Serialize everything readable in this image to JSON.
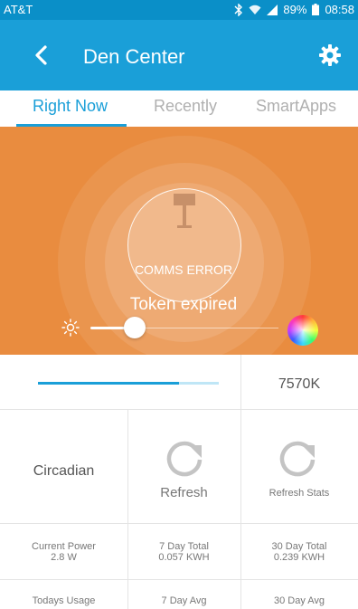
{
  "status": {
    "carrier": "AT&T",
    "battery": "89%",
    "time": "08:58"
  },
  "appbar": {
    "title": "Den Center"
  },
  "tabs": [
    {
      "label": "Right Now",
      "active": true
    },
    {
      "label": "Recently",
      "active": false
    },
    {
      "label": "SmartApps",
      "active": false
    }
  ],
  "hero": {
    "error_text": "COMMS ERROR",
    "message": "Token expired",
    "brightness_level": 0.25,
    "accent_color": "#e98c3f"
  },
  "tiles": {
    "level_fill": 0.78,
    "color_temp": "7570K",
    "circadian_label": "Circadian",
    "refresh_label": "Refresh",
    "refresh_stats_label": "Refresh Stats"
  },
  "stats": {
    "current_power_label": "Current Power",
    "current_power_value": "2.8 W",
    "seven_day_total_label": "7 Day Total",
    "seven_day_total_value": "0.057 KWH",
    "thirty_day_total_label": "30 Day Total",
    "thirty_day_total_value": "0.239 KWH",
    "todays_usage_label": "Todays Usage",
    "seven_day_avg_label": "7 Day Avg",
    "thirty_day_avg_label": "30 Day Avg"
  },
  "colors": {
    "primary": "#1a9fd8",
    "statusbar": "#0a8fc8"
  }
}
